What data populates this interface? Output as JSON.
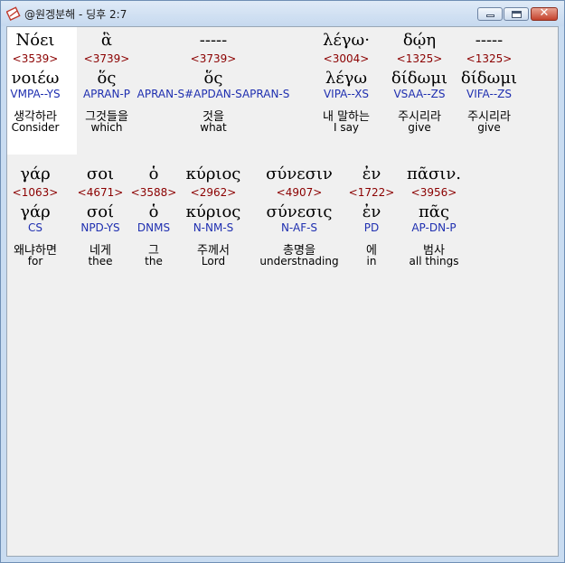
{
  "window": {
    "title": "@원겡분해 - 딩후 2:7",
    "close_label": "✕"
  },
  "row1": [
    {
      "greek": "Νόει",
      "strong": "<3539>",
      "lemma": "νοιέω",
      "parse": "VMPA--YS",
      "korean": "생각하라",
      "english": "Consider"
    },
    {
      "greek": "ἃ",
      "strong": "<3739>",
      "lemma": "ὅς",
      "parse": "APRAN-P",
      "korean": "그것들을",
      "english": "which"
    },
    {
      "greek": "-----",
      "strong": "<3739>",
      "lemma": "ὅς",
      "parse": "APRAN-S#APDAN-SAPRAN-S",
      "korean": "것을",
      "english": "what"
    },
    {
      "greek": "λέγω·",
      "strong": "<3004>",
      "lemma": "λέγω",
      "parse": "VIPA--XS",
      "korean": "내 말하는",
      "english": "I say"
    },
    {
      "greek": "δῴη",
      "strong": "<1325>",
      "lemma": "δίδωμι",
      "parse": "VSAA--ZS",
      "korean": "주시리라",
      "english": "give"
    },
    {
      "greek": "-----",
      "strong": "<1325>",
      "lemma": "δίδωμι",
      "parse": "VIFA--ZS",
      "korean": "주시리라",
      "english": "give"
    }
  ],
  "row2": [
    {
      "greek": "γάρ",
      "strong": "<1063>",
      "lemma": "γάρ",
      "parse": "CS",
      "korean": "왜냐하면",
      "english": "for"
    },
    {
      "greek": "σοι",
      "strong": "<4671>",
      "lemma": "σοί",
      "parse": "NPD-YS",
      "korean": "네게",
      "english": "thee"
    },
    {
      "greek": "ὁ",
      "strong": "<3588>",
      "lemma": "ὁ",
      "parse": "DNMS",
      "korean": "그",
      "english": "the"
    },
    {
      "greek": "κύριος",
      "strong": "<2962>",
      "lemma": "κύριος",
      "parse": "N-NM-S",
      "korean": "주께서",
      "english": "Lord"
    },
    {
      "greek": "σύνεσιν",
      "strong": "<4907>",
      "lemma": "σύνεσις",
      "parse": "N-AF-S",
      "korean": "총명을",
      "english": "understnading"
    },
    {
      "greek": "ἐν",
      "strong": "<1722>",
      "lemma": "ἐν",
      "parse": "PD",
      "korean": "에",
      "english": "in"
    },
    {
      "greek": "πᾶσιν.",
      "strong": "<3956>",
      "lemma": "πᾶς",
      "parse": "AP-DN-P",
      "korean": "범사",
      "english": "all things"
    }
  ]
}
